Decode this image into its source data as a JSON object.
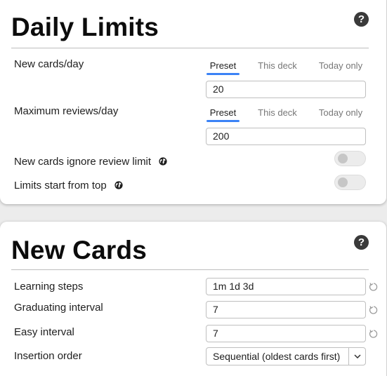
{
  "daily_limits": {
    "title": "Daily Limits",
    "help_icon": "?",
    "new_cards": {
      "label": "New cards/day",
      "tabs": [
        "Preset",
        "This deck",
        "Today only"
      ],
      "active_tab": "Preset",
      "value": "20"
    },
    "max_reviews": {
      "label": "Maximum reviews/day",
      "tabs": [
        "Preset",
        "This deck",
        "Today only"
      ],
      "active_tab": "Preset",
      "value": "200"
    },
    "ignore_review_limit": {
      "label": "New cards ignore review limit",
      "icon": "globe-icon",
      "enabled": false
    },
    "limits_from_top": {
      "label": "Limits start from top",
      "icon": "globe-icon",
      "enabled": false
    }
  },
  "new_cards": {
    "title": "New Cards",
    "help_icon": "?",
    "learning_steps": {
      "label": "Learning steps",
      "value": "1m 1d 3d"
    },
    "graduating_interval": {
      "label": "Graduating interval",
      "value": "7"
    },
    "easy_interval": {
      "label": "Easy interval",
      "value": "7"
    },
    "insertion_order": {
      "label": "Insertion order",
      "value": "Sequential (oldest cards first)"
    }
  },
  "colors": {
    "accent": "#3b82f6",
    "card_background": "#ffffff",
    "page_background": "#ececec"
  }
}
